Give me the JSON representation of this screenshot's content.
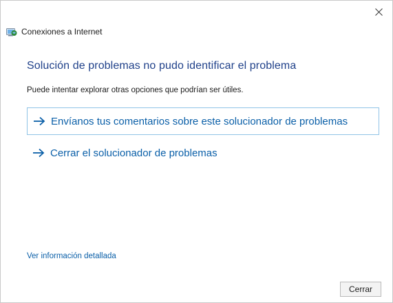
{
  "window": {
    "title": "Conexiones a Internet",
    "close_label": "×"
  },
  "main": {
    "heading": "Solución de problemas no pudo identificar el problema",
    "subtext": "Puede intentar explorar otras opciones que podrían ser útiles.",
    "options": [
      {
        "label": "Envíanos tus comentarios sobre este solucionador de problemas",
        "icon": "arrow-right-icon"
      },
      {
        "label": "Cerrar el solucionador de problemas",
        "icon": "arrow-right-icon"
      }
    ],
    "details_link": "Ver información detallada"
  },
  "footer": {
    "close_button_label": "Cerrar"
  },
  "colors": {
    "link": "#0a5fa8",
    "heading": "#20418a",
    "focus_border": "#8fc3e6"
  }
}
